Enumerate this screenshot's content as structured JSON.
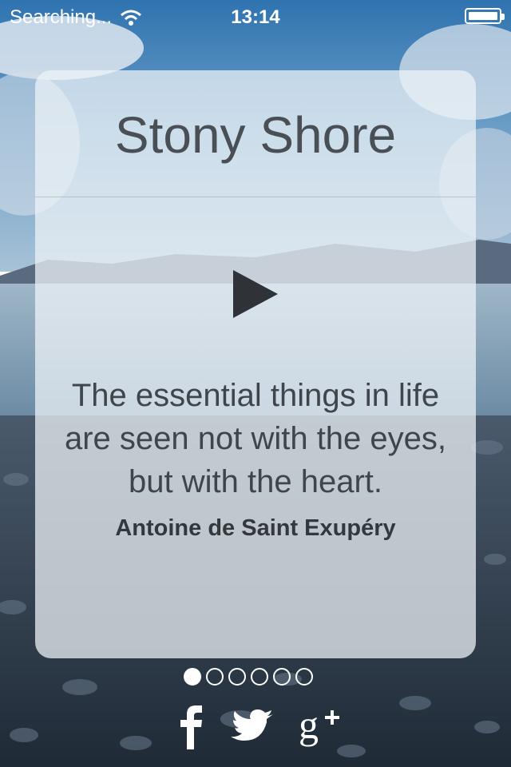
{
  "status_bar": {
    "carrier": "Searching...",
    "time": "13:14",
    "wifi_icon": "wifi-icon",
    "battery_icon": "battery-icon"
  },
  "card": {
    "title": "Stony Shore",
    "play_icon": "play-icon",
    "quote": "The essential things in life are seen not with the eyes, but with the heart.",
    "author": "Antoine de Saint Exupéry"
  },
  "pager": {
    "total": 6,
    "active_index": 0
  },
  "social": [
    {
      "name": "facebook-icon"
    },
    {
      "name": "twitter-icon"
    },
    {
      "name": "google-plus-icon"
    }
  ],
  "colors": {
    "card_background": "#eef3f7",
    "text_dark": "#3f454b",
    "sky_blue": "#3d7fb8"
  }
}
